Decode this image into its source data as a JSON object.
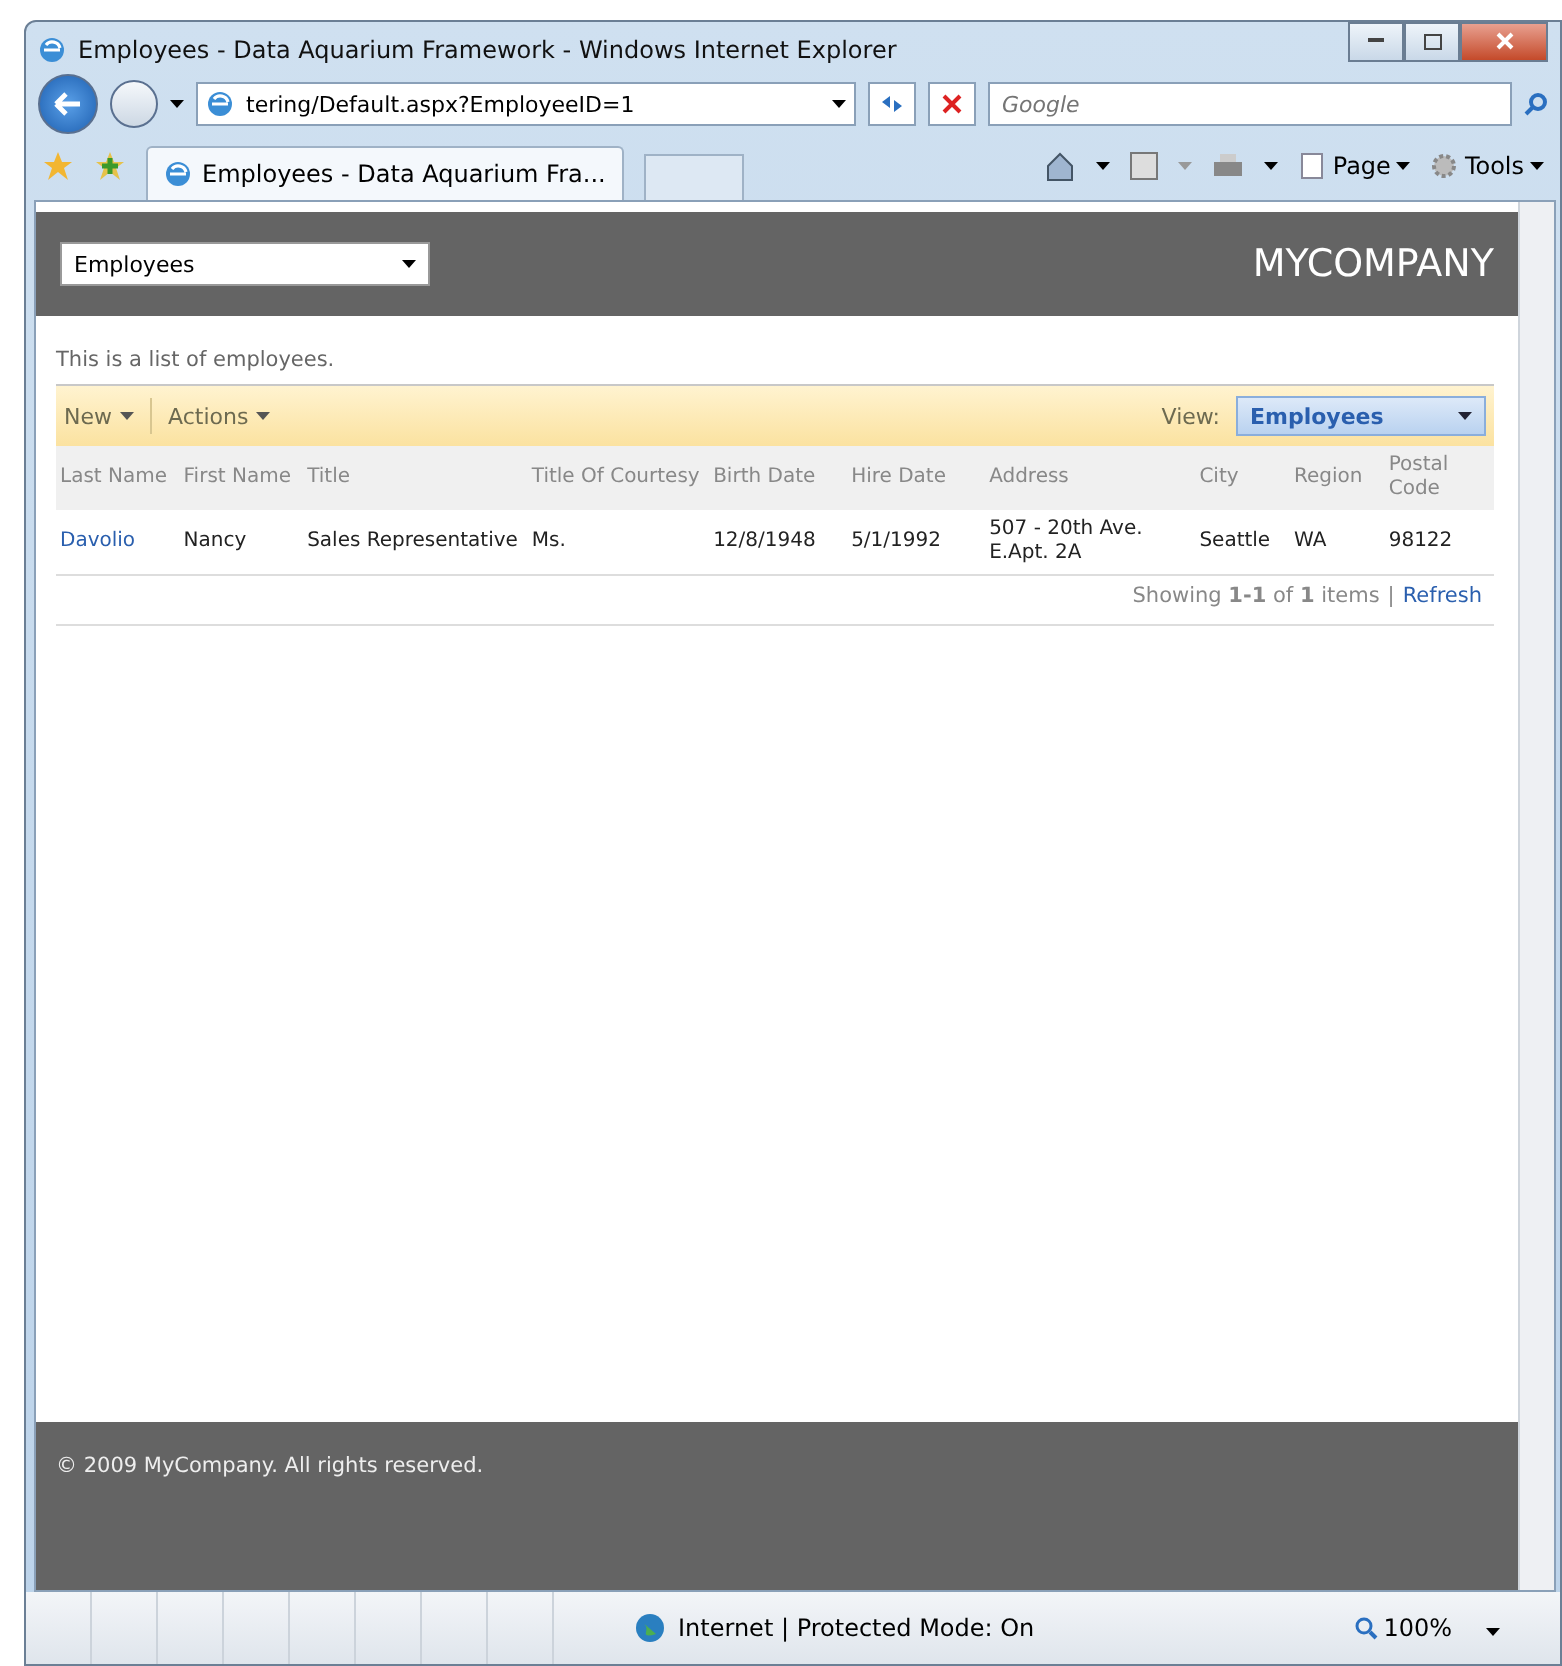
{
  "window": {
    "title": "Employees - Data Aquarium Framework - Windows Internet Explorer"
  },
  "address_bar": {
    "url": "tering/Default.aspx?EmployeeID=1",
    "search_placeholder": "Google"
  },
  "tabs": [
    {
      "label": "Employees - Data Aquarium Fra...",
      "selected": true
    }
  ],
  "command_bar": [
    "Page",
    "Tools"
  ],
  "page": {
    "header": {
      "selector": "Employees",
      "brand": "MYCOMPANY"
    },
    "description": "This is a list of employees.",
    "toolbar": {
      "actions": [
        "New",
        "Actions"
      ],
      "view_label": "View:",
      "view_value": "Employees"
    },
    "table": {
      "columns": [
        "Last Name",
        "First Name",
        "Title",
        "Title Of Courtesy",
        "Birth Date",
        "Hire Date",
        "Address",
        "City",
        "Region",
        "Postal Code"
      ],
      "rows": [
        [
          "Davolio",
          "Nancy",
          "Sales Representative",
          "Ms.",
          "12/8/1948",
          "5/1/1992",
          "507 - 20th Ave. E.Apt. 2A",
          "Seattle",
          "WA",
          "98122"
        ]
      ]
    },
    "pager": {
      "text": "Showing **1-1** of **1** items",
      "separator": "|",
      "link": "Refresh"
    },
    "footer": "© 2009 MyCompany. All rights reserved."
  },
  "status_bar": {
    "zone": "Internet | Protected Mode: On",
    "zoom": "100%"
  }
}
